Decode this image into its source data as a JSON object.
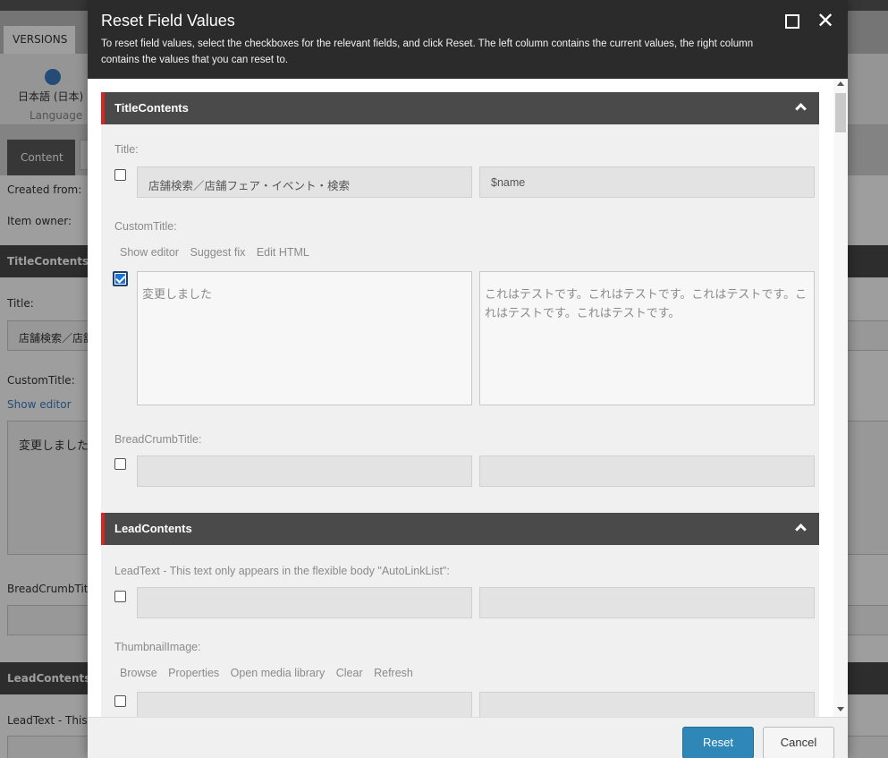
{
  "background": {
    "ribbon_tab": "VERSIONS",
    "language_value": "日本語 (日本)",
    "language_caption": "Language",
    "tabs": [
      "Content"
    ],
    "fields": {
      "created_from": "Created from:",
      "item_owner": "Item owner:",
      "title_label": "Title:",
      "title_value": "店舗検索／店舗",
      "custom_title_label": "CustomTitle:",
      "show_editor": "Show editor",
      "custom_title_value": "変更しました",
      "breadcrumb_label": "BreadCrumbTitle",
      "leadtext_label": "LeadText - This t"
    },
    "sections": [
      "TitleContents",
      "LeadContents"
    ]
  },
  "dialog": {
    "title": "Reset Field Values",
    "description": "To reset field values, select the checkboxes for the relevant fields, and click Reset. The left column contains the current values, the right column contains the values that you can reset to.",
    "sections": [
      {
        "name": "TitleContents",
        "fields": [
          {
            "label": "Title:",
            "checked": false,
            "current": "店舗検索／店舗フェア・イベント・検索",
            "reset_to": "$name"
          },
          {
            "label": "CustomTitle:",
            "checked": true,
            "editor_links": [
              "Show editor",
              "Suggest fix",
              "Edit HTML"
            ],
            "current": "変更しました",
            "reset_to": "これはテストです。これはテストです。これはテストです。これはテストです。これはテストです。"
          },
          {
            "label": "BreadCrumbTitle:",
            "checked": false,
            "current": "",
            "reset_to": ""
          }
        ]
      },
      {
        "name": "LeadContents",
        "fields": [
          {
            "label": "LeadText - This text only appears in the flexible body \"AutoLinkList\":",
            "checked": false,
            "current": "",
            "reset_to": ""
          },
          {
            "label": "ThumbnailImage:",
            "checked": false,
            "editor_links": [
              "Browse",
              "Properties",
              "Open media library",
              "Clear",
              "Refresh"
            ],
            "current": "",
            "reset_to": ""
          }
        ]
      }
    ],
    "buttons": {
      "reset": "Reset",
      "cancel": "Cancel"
    }
  },
  "icons": [
    "globe-icon",
    "maximize-icon",
    "close-icon",
    "chevron-up-icon",
    "checkbox-icon"
  ],
  "colors": {
    "accent": "#dd2222",
    "primary_button": "#2f87b8",
    "header": "#2b2b2b",
    "section": "#4a4a4a"
  }
}
